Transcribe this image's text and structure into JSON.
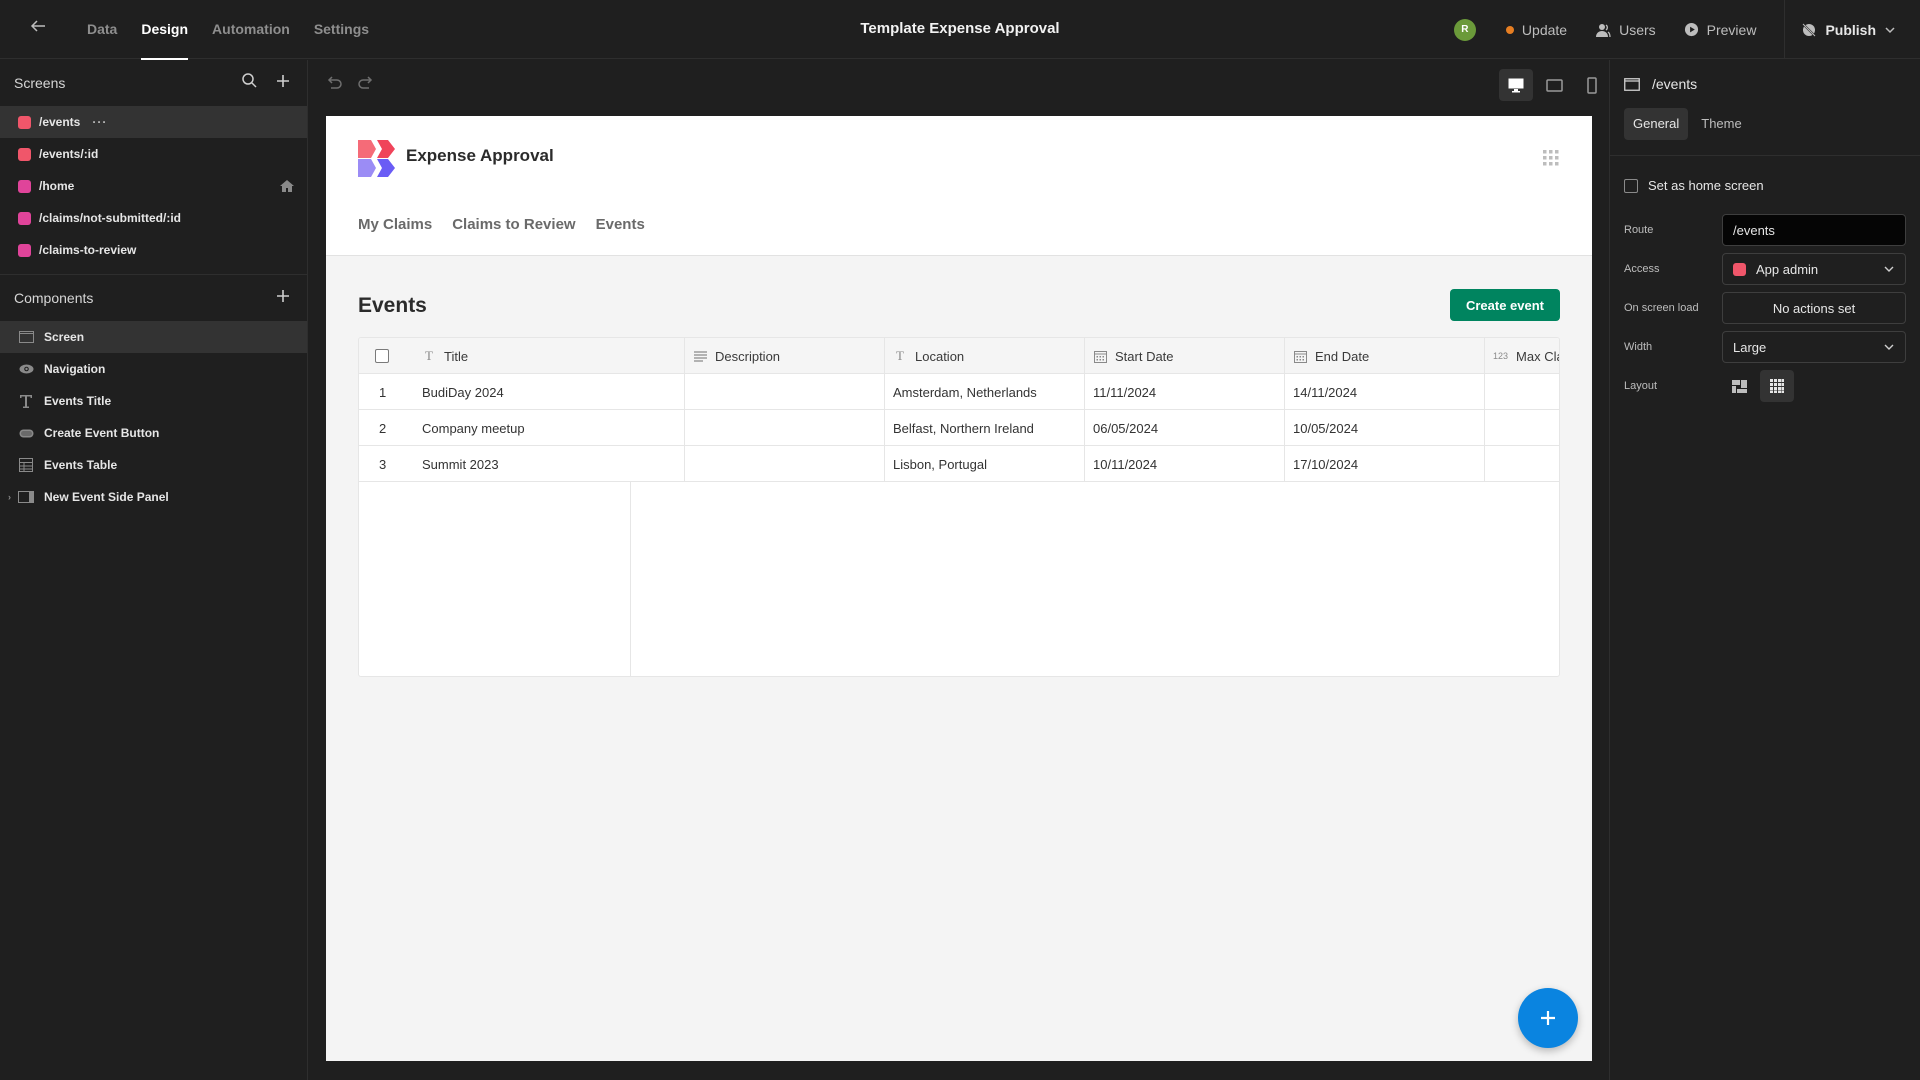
{
  "topbar": {
    "back_icon": "arrow-left-icon",
    "tabs": [
      {
        "label": "Data",
        "active": false
      },
      {
        "label": "Design",
        "active": true
      },
      {
        "label": "Automation",
        "active": false
      },
      {
        "label": "Settings",
        "active": false
      }
    ],
    "app_title": "Template Expense Approval",
    "avatar_initial": "R",
    "avatar_color": "#6b9a3a",
    "update_label": "Update",
    "update_dot_color": "#e67e22",
    "users_label": "Users",
    "preview_label": "Preview",
    "publish_label": "Publish"
  },
  "sidebar": {
    "screens_heading": "Screens",
    "screens": [
      {
        "route": "/events",
        "color": "#f0566a",
        "active": true,
        "more": "···"
      },
      {
        "route": "/events/:id",
        "color": "#f0566a",
        "active": false
      },
      {
        "route": "/home",
        "color": "#e0449a",
        "active": false,
        "home": true
      },
      {
        "route": "/claims/not-submitted/:id",
        "color": "#e0449a",
        "active": false
      },
      {
        "route": "/claims-to-review",
        "color": "#e0449a",
        "active": false
      }
    ],
    "components_heading": "Components",
    "components": [
      {
        "label": "Screen",
        "icon": "screen-icon",
        "active": true
      },
      {
        "label": "Navigation",
        "icon": "eye-icon",
        "active": false
      },
      {
        "label": "Events Title",
        "icon": "text-icon",
        "active": false
      },
      {
        "label": "Create Event Button",
        "icon": "button-icon",
        "active": false
      },
      {
        "label": "Events Table",
        "icon": "table-icon",
        "active": false
      },
      {
        "label": "New Event Side Panel",
        "icon": "side-panel-icon",
        "active": false,
        "expandable": true
      }
    ]
  },
  "canvas": {
    "device_modes": [
      "desktop",
      "tablet",
      "mobile"
    ],
    "active_device": "desktop"
  },
  "app_preview": {
    "app_name": "Expense Approval",
    "nav": [
      "My Claims",
      "Claims to Review",
      "Events"
    ],
    "page_title": "Events",
    "create_button": "Create event",
    "brand_colors": {
      "primary_button": "#00845f",
      "fab": "#0a84e0"
    },
    "table": {
      "columns": [
        {
          "label": "Title",
          "icon": "text-icon"
        },
        {
          "label": "Description",
          "icon": "long-text-icon"
        },
        {
          "label": "Location",
          "icon": "text-icon"
        },
        {
          "label": "Start Date",
          "icon": "calendar-icon"
        },
        {
          "label": "End Date",
          "icon": "calendar-icon"
        },
        {
          "label": "Max Claim",
          "icon": "number-icon",
          "icon_text": "123"
        }
      ],
      "rows": [
        {
          "index": "1",
          "title": "BudiDay 2024",
          "description": "",
          "location": "Amsterdam, Netherlands",
          "start": "11/11/2024",
          "end": "14/11/2024",
          "max_claim": ""
        },
        {
          "index": "2",
          "title": "Company meetup",
          "description": "",
          "location": "Belfast, Northern Ireland",
          "start": "06/05/2024",
          "end": "10/05/2024",
          "max_claim": ""
        },
        {
          "index": "3",
          "title": "Summit 2023",
          "description": "",
          "location": "Lisbon, Portugal",
          "start": "10/11/2024",
          "end": "17/10/2024",
          "max_claim": ""
        }
      ]
    },
    "fab_icon": "plus-icon"
  },
  "right_panel": {
    "screen_route": "/events",
    "tabs": [
      {
        "label": "General",
        "active": true
      },
      {
        "label": "Theme",
        "active": false
      }
    ],
    "home_checkbox_label": "Set as home screen",
    "home_checked": false,
    "fields": {
      "route": {
        "label": "Route",
        "value": "/events"
      },
      "access": {
        "label": "Access",
        "value": "App admin",
        "color": "#f0566a"
      },
      "on_load": {
        "label": "On screen load",
        "value": "No actions set"
      },
      "width": {
        "label": "Width",
        "value": "Large"
      },
      "layout": {
        "label": "Layout",
        "active": "grid"
      }
    }
  }
}
